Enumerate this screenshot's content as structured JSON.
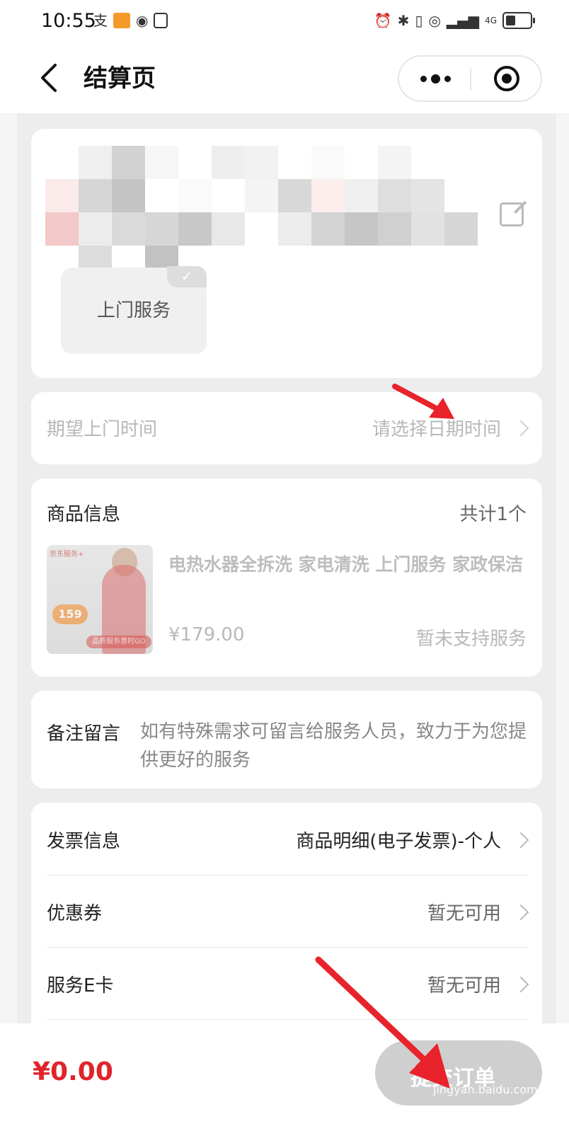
{
  "status_bar": {
    "time": "10:55",
    "left_icons": [
      "alipay-icon",
      "app-badge-icon",
      "eye-icon",
      "nfc-icon"
    ],
    "right_icons": [
      "alarm-icon",
      "bluetooth-icon",
      "vibrate-icon",
      "hotspot-icon",
      "signal-icon",
      "signal-4g-icon",
      "battery-icon"
    ],
    "network_label": "4G"
  },
  "nav": {
    "title": "结算页"
  },
  "service_type": {
    "label": "上门服务",
    "selected": true
  },
  "appointment": {
    "label": "期望上门时间",
    "placeholder": "请选择日期时间"
  },
  "product_section": {
    "title": "商品信息",
    "count": "共计1个",
    "image_brand": "京东服务+",
    "image_badge": "159",
    "image_banner": "品质服务惠时GO",
    "name": "电热水器全拆洗 家电清洗 上门服务 家政保洁",
    "price": "¥179.00",
    "status": "暂未支持服务"
  },
  "remark": {
    "label": "备注留言",
    "placeholder": "如有特殊需求可留言给服务人员，致力于为您提供更好的服务"
  },
  "options": [
    {
      "label": "发票信息",
      "value": "商品明细(电子发票)-个人"
    },
    {
      "label": "优惠券",
      "value": "暂无可用"
    },
    {
      "label": "服务E卡",
      "value": "暂无可用"
    }
  ],
  "footer": {
    "total": "¥0.00",
    "submit_label": "提交订单",
    "watermark": "jingyan.baidu.com"
  },
  "colors": {
    "accent_red": "#e0242b",
    "arrow_red": "#e8232c"
  }
}
